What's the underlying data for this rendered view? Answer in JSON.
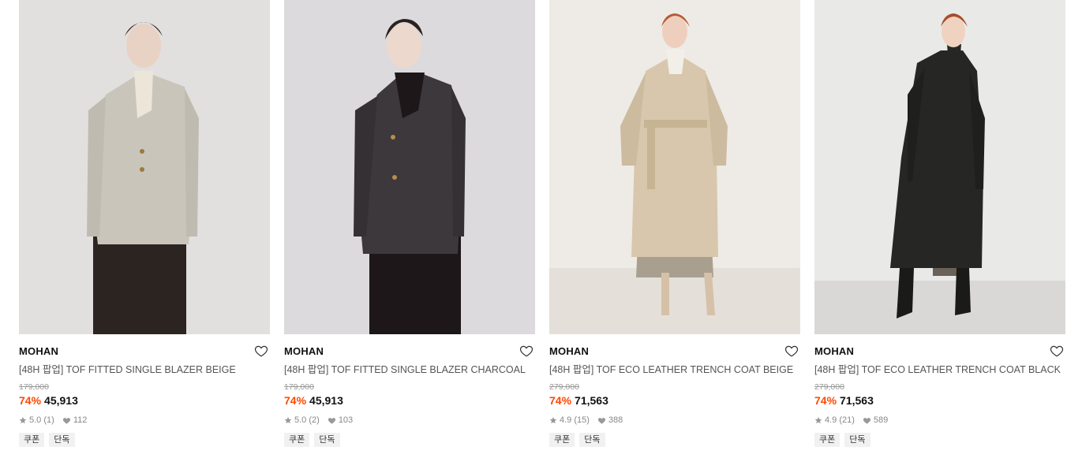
{
  "products": [
    {
      "brand": "MOHAN",
      "name": "[48H 팝업] TOF FITTED SINGLE BLAZER BEIGE",
      "original_price": "179,000",
      "discount": "74%",
      "price": "45,913",
      "rating": "5.0",
      "review_count": "(1)",
      "likes": "112",
      "tags": [
        "쿠폰",
        "단독"
      ],
      "colors": {
        "bg": "#e2e0df",
        "garment": "#c9c5ba",
        "skirt": "#2c2420",
        "inner": "#ece6d8"
      }
    },
    {
      "brand": "MOHAN",
      "name": "[48H 팝업] TOF FITTED SINGLE BLAZER CHARCOAL",
      "original_price": "179,000",
      "discount": "74%",
      "price": "45,913",
      "rating": "5.0",
      "review_count": "(2)",
      "likes": "103",
      "tags": [
        "쿠폰",
        "단독"
      ],
      "colors": {
        "bg": "#dcdadc",
        "garment": "#3c383b",
        "skirt": "#1d1719",
        "inner": "#1d1719"
      }
    },
    {
      "brand": "MOHAN",
      "name": "[48H 팝업] TOF ECO LEATHER TRENCH COAT BEIGE",
      "original_price": "279,000",
      "discount": "74%",
      "price": "71,563",
      "rating": "4.9",
      "review_count": "(15)",
      "likes": "388",
      "tags": [
        "쿠폰",
        "단독"
      ],
      "colors": {
        "bg": "#eeebe6",
        "garment": "#d8c7ac",
        "skirt": "#a89f8f",
        "inner": "#f2efe8"
      }
    },
    {
      "brand": "MOHAN",
      "name": "[48H 팝업] TOF ECO LEATHER TRENCH COAT BLACK",
      "original_price": "279,000",
      "discount": "74%",
      "price": "71,563",
      "rating": "4.9",
      "review_count": "(21)",
      "likes": "589",
      "tags": [
        "쿠폰",
        "단독"
      ],
      "colors": {
        "bg": "#e9e9e8",
        "garment": "#262725",
        "skirt": "#6a6259",
        "inner": "#262725"
      }
    }
  ],
  "icons": {
    "wishlist": "heart-outline-icon",
    "rating": "star-icon",
    "likes": "heart-filled-icon"
  },
  "accent_color": "#ff4800"
}
